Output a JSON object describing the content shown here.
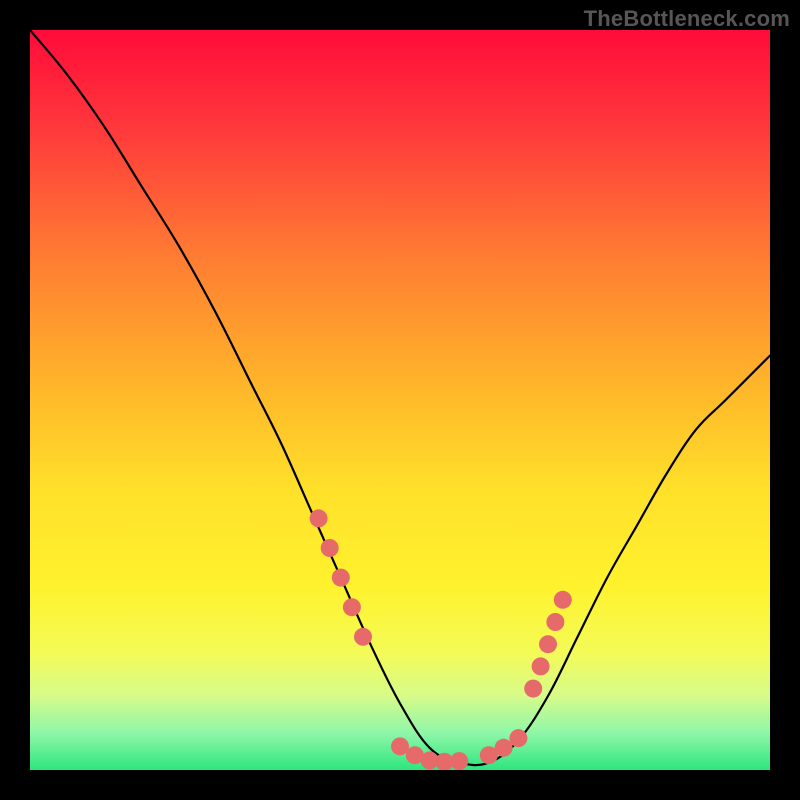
{
  "watermark": "TheBottleneck.com",
  "chart_data": {
    "type": "line",
    "title": "",
    "xlabel": "",
    "ylabel": "",
    "xlim": [
      0,
      100
    ],
    "ylim": [
      0,
      100
    ],
    "series": [
      {
        "name": "curve",
        "x": [
          0,
          5,
          10,
          15,
          20,
          25,
          30,
          34,
          38,
          42,
          46,
          50,
          54,
          58,
          62,
          66,
          70,
          74,
          78,
          82,
          86,
          90,
          94,
          100
        ],
        "y": [
          100,
          94,
          87,
          79,
          71,
          62,
          52,
          44,
          35,
          26,
          17,
          9,
          3,
          1,
          1,
          4,
          10,
          18,
          26,
          33,
          40,
          46,
          50,
          56
        ]
      }
    ],
    "highlight_range": {
      "x_start": 39,
      "x_end": 70
    },
    "highlight_points_left": [
      {
        "x": 39,
        "y": 34
      },
      {
        "x": 40.5,
        "y": 30
      },
      {
        "x": 42,
        "y": 26
      },
      {
        "x": 43.5,
        "y": 22
      },
      {
        "x": 45,
        "y": 18
      }
    ],
    "highlight_points_right": [
      {
        "x": 68,
        "y": 11
      },
      {
        "x": 69,
        "y": 14
      },
      {
        "x": 70,
        "y": 17
      },
      {
        "x": 71,
        "y": 20
      },
      {
        "x": 72,
        "y": 23
      }
    ],
    "bottom_dots": [
      {
        "x": 50,
        "y": 3.2
      },
      {
        "x": 52,
        "y": 2.0
      },
      {
        "x": 54,
        "y": 1.3
      },
      {
        "x": 56,
        "y": 1.1
      },
      {
        "x": 58,
        "y": 1.2
      },
      {
        "x": 62,
        "y": 2.0
      },
      {
        "x": 64,
        "y": 3.0
      },
      {
        "x": 66,
        "y": 4.3
      }
    ],
    "gradient_stops": [
      {
        "offset": 0,
        "color": "#ff0b3a"
      },
      {
        "offset": 14,
        "color": "#ff3b3b"
      },
      {
        "offset": 30,
        "color": "#ff7a33"
      },
      {
        "offset": 48,
        "color": "#ffb52a"
      },
      {
        "offset": 62,
        "color": "#ffe02a"
      },
      {
        "offset": 75,
        "color": "#fff22d"
      },
      {
        "offset": 84,
        "color": "#f4fb56"
      },
      {
        "offset": 90,
        "color": "#d7fb8a"
      },
      {
        "offset": 95,
        "color": "#8ef7a8"
      },
      {
        "offset": 100,
        "color": "#2ee57e"
      }
    ],
    "dot_color": "#e66a6a",
    "curve_color": "#000000"
  }
}
